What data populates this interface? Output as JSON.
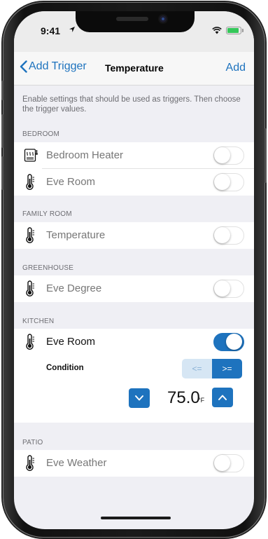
{
  "status_bar": {
    "time": "9:41"
  },
  "nav": {
    "back_label": "Add Trigger",
    "title": "Temperature",
    "action_label": "Add"
  },
  "intro": "Enable settings that should be used as triggers. Then choose the trigger values.",
  "sections": [
    {
      "header": "BEDROOM",
      "rows": [
        {
          "icon": "heater-icon",
          "label": "Bedroom Heater",
          "enabled": false
        },
        {
          "icon": "thermometer-icon",
          "label": "Eve Room",
          "enabled": false
        }
      ]
    },
    {
      "header": "FAMILY ROOM",
      "rows": [
        {
          "icon": "thermometer-icon",
          "label": "Temperature",
          "enabled": false
        }
      ]
    },
    {
      "header": "GREENHOUSE",
      "rows": [
        {
          "icon": "thermometer-icon",
          "label": "Eve Degree",
          "enabled": false
        }
      ]
    },
    {
      "header": "KITCHEN",
      "rows": [
        {
          "icon": "thermometer-icon",
          "label": "Eve Room",
          "enabled": true
        }
      ],
      "condition": {
        "label": "Condition",
        "options": [
          "<=",
          ">="
        ],
        "selected": ">=",
        "value": "75.0",
        "unit": "°F"
      }
    },
    {
      "header": "PATIO",
      "rows": [
        {
          "icon": "thermometer-icon",
          "label": "Eve Weather",
          "enabled": false
        }
      ]
    }
  ],
  "colors": {
    "accent": "#1e73be",
    "background": "#efeff4",
    "toggle_off_border": "#e1e1e1"
  }
}
